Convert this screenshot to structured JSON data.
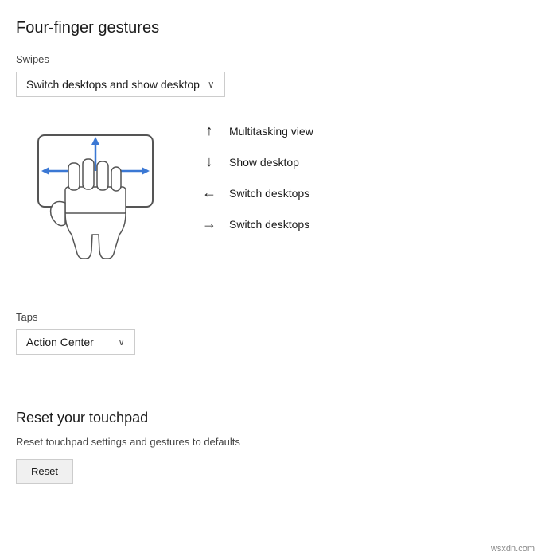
{
  "page": {
    "four_finger_title": "Four-finger gestures",
    "swipes_label": "Swipes",
    "swipes_dropdown_value": "Switch desktops and show desktop",
    "swipes_dropdown_arrow": "∨",
    "gestures": [
      {
        "direction": "↑",
        "label": "Multitasking view"
      },
      {
        "direction": "↓",
        "label": "Show desktop"
      },
      {
        "direction": "←",
        "label": "Switch desktops"
      },
      {
        "direction": "→",
        "label": "Switch desktops"
      }
    ],
    "taps_label": "Taps",
    "taps_dropdown_value": "Action Center",
    "taps_dropdown_arrow": "∨",
    "reset_title": "Reset your touchpad",
    "reset_desc": "Reset touchpad settings and gestures to defaults",
    "reset_button_label": "Reset",
    "watermark": "wsxdn.com"
  }
}
